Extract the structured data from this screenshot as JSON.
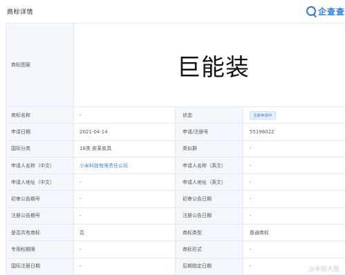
{
  "header": {
    "title": "商标详情",
    "logo_text": "企查查"
  },
  "mark": {
    "label": "商标图案",
    "text": "巨能装"
  },
  "rows": [
    {
      "l1": "商标名称",
      "v1": "-",
      "l2": "状态",
      "v2": "注册申请中"
    },
    {
      "l1": "申请日期",
      "v1": "2021-04-14",
      "l2": "申请/注册号",
      "v2": "55196022"
    },
    {
      "l1": "国际分类",
      "v1": "18类 皮革皮具",
      "l2": "类似群",
      "v2": "-"
    },
    {
      "l1": "申请人名称（中文）",
      "v1": "小米科技有限责任公司",
      "l2": "申请人名称（英文）",
      "v2": "-"
    },
    {
      "l1": "申请人地址（中文）",
      "v1": "-",
      "l2": "申请人地址（英文）",
      "v2": "-"
    },
    {
      "l1": "初审公告期号",
      "v1": "-",
      "l2": "初审公告日期",
      "v2": "-"
    },
    {
      "l1": "注册公告期号",
      "v1": "-",
      "l2": "注册公告日期",
      "v2": "-"
    },
    {
      "l1": "是否共有商标",
      "v1": "否",
      "l2": "商标类型",
      "v2": "普通商标"
    },
    {
      "l1": "专用权期限",
      "v1": "-",
      "l2": "商标形式",
      "v2": "-"
    },
    {
      "l1": "国际注册日期",
      "v1": "-",
      "l2": "后期指定日期",
      "v2": "-"
    }
  ],
  "watermark": "@未脑大猩"
}
